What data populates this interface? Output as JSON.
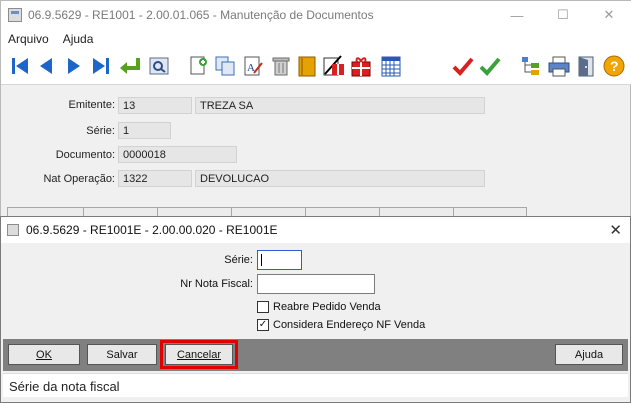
{
  "main_window": {
    "title": "06.9.5629 - RE1001 - 2.00.01.065 - Manutenção de Documentos",
    "menu": [
      "Arquivo",
      "Ajuda"
    ],
    "controls": {
      "minimize": "—",
      "maximize": "☐",
      "close": "✕"
    }
  },
  "toolbar": {
    "icons": [
      "first-record-icon",
      "previous-record-icon",
      "next-record-icon",
      "last-record-icon",
      "goto-icon",
      "search-icon",
      "new-icon",
      "copy-icon",
      "edit-icon",
      "delete-icon",
      "book-icon",
      "document-gift-icon",
      "gift-icon",
      "calendar-icon",
      "confirm-red-icon",
      "confirm-green-icon",
      "tree-icon",
      "print-icon",
      "exit-icon",
      "help-icon"
    ]
  },
  "header": {
    "emitente_label": "Emitente:",
    "emitente_code": "13",
    "emitente_name": "TREZA SA",
    "serie_label": "Série:",
    "serie_value": "1",
    "documento_label": "Documento:",
    "documento_value": "0000018",
    "natop_label": "Nat Operação:",
    "natop_code": "1322",
    "natop_desc": "DEVOLUCAO"
  },
  "dialog": {
    "title": "06.9.5629 - RE1001E - 2.00.00.020 - RE1001E",
    "close": "✕",
    "serie_label": "Série:",
    "serie_value": "",
    "nota_label": "Nr Nota Fiscal:",
    "nota_value": "",
    "reabre_label": "Reabre Pedido Venda",
    "reabre_checked": "",
    "considera_label": "Considera Endereço NF Venda",
    "considera_checked": "✓",
    "buttons": {
      "ok": "OK",
      "salvar": "Salvar",
      "cancelar": "Cancelar",
      "ajuda": "Ajuda"
    },
    "status_text": "Série da nota fiscal"
  }
}
